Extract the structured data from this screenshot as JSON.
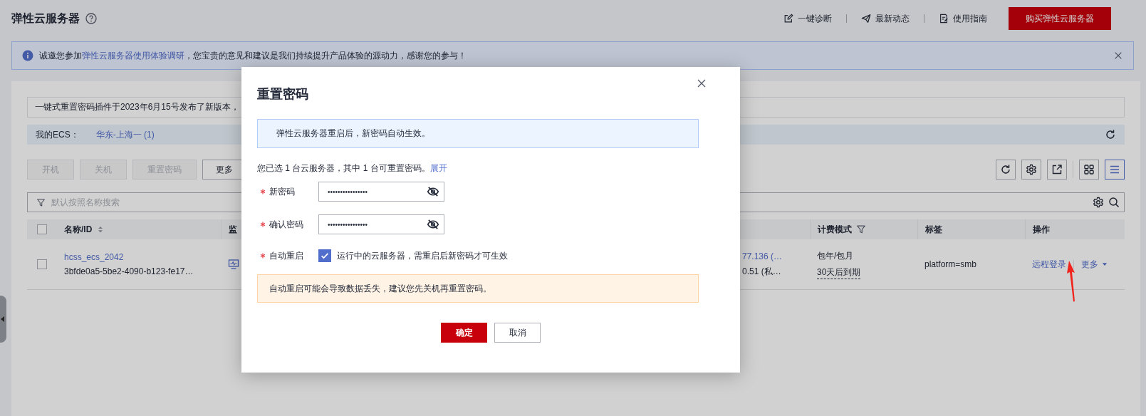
{
  "header": {
    "title": "弹性云服务器",
    "links": [
      {
        "label": "一键诊断"
      },
      {
        "label": "最新动态"
      },
      {
        "label": "使用指南"
      }
    ],
    "buy_button": "购买弹性云服务器"
  },
  "survey_banner": {
    "before": "诚邀您参加",
    "link": "弹性云服务器使用体验调研",
    "after": "，您宝贵的意见和建议是我们持续提升产品体验的源动力，感谢您的参与！"
  },
  "notice": "一键式重置密码插件于2023年6月15号发布了新版本，",
  "my_ecs": {
    "label": "我的ECS：",
    "region": "华东-上海一 (1)"
  },
  "toolbar": {
    "buttons": [
      {
        "label": "开机",
        "disabled": true
      },
      {
        "label": "关机",
        "disabled": true
      },
      {
        "label": "重置密码",
        "disabled": true
      },
      {
        "label": "更多",
        "disabled": false
      }
    ],
    "tools": [
      {
        "kind": "refresh"
      },
      {
        "kind": "gear"
      },
      {
        "kind": "export"
      }
    ],
    "views": [
      {
        "kind": "grid",
        "selected": false
      },
      {
        "kind": "list",
        "selected": true
      }
    ]
  },
  "search": {
    "placeholder": "默认按照名称搜索"
  },
  "table": {
    "all_checked": false,
    "columns": [
      {
        "label": "名称/ID",
        "sortable": true
      },
      {
        "label": "监"
      },
      {},
      {
        "label": "计费模式",
        "filter": true
      },
      {
        "label": "标签"
      },
      {
        "label": "操作"
      }
    ],
    "rows": [
      {
        "checked": false,
        "name": "hcss_ecs_2042",
        "id": "3bfde0a5-5be2-4090-b123-fe17…",
        "ip_1": "77.136 (…",
        "ip_2": "0.51 (私…",
        "billing": "包年/包月",
        "expiry": "30天后到期",
        "tag": "platform=smb",
        "actions": [
          "远程登录",
          "更多"
        ]
      }
    ]
  },
  "dialog": {
    "title": "重置密码",
    "info": "弹性云服务器重启后，新密码自动生效。",
    "selection": "您已选 1 台云服务器，其中 1 台可重置密码。",
    "expand_link": "展开",
    "fields": [
      {
        "label": "新密码",
        "required": true,
        "value": "••••••••••••••••"
      },
      {
        "label": "确认密码",
        "required": true,
        "value": "••••••••••••••••"
      }
    ],
    "auto_restart": {
      "label": "自动重启",
      "required": true,
      "checked": true,
      "text": "运行中的云服务器，需重启后新密码才可生效"
    },
    "warning": "自动重启可能会导致数据丢失，建议您先关机再重置密码。",
    "buttons": [
      {
        "label": "确定",
        "kind": "primary"
      },
      {
        "label": "取消",
        "kind": "default"
      }
    ]
  }
}
